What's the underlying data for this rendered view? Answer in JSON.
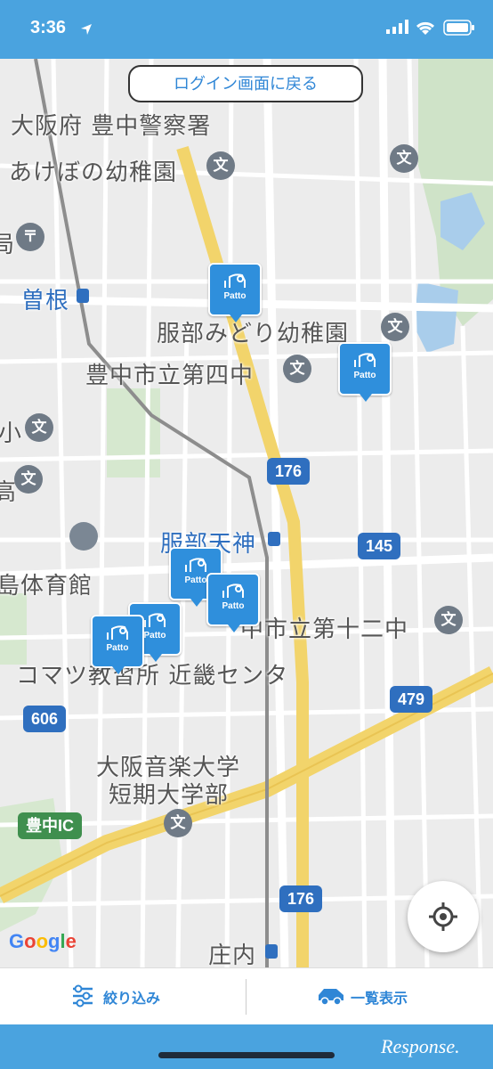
{
  "status_bar": {
    "time": "3:36"
  },
  "login_button": "ログイン画面に戻る",
  "map": {
    "labels": [
      {
        "text": "大阪府 豊中警察署"
      },
      {
        "text": "あけぼの幼稚園"
      },
      {
        "text": "曽根"
      },
      {
        "text": "服部みどり幼稚園"
      },
      {
        "text": "豊中市立第四中"
      },
      {
        "text": "服部天神"
      },
      {
        "text": "島体育館"
      },
      {
        "text": "中市立第十二中"
      },
      {
        "text": "コマツ教習所 近畿センタ"
      },
      {
        "text": "大阪音楽大学"
      },
      {
        "text": "短期大学部"
      },
      {
        "text": "庄内"
      },
      {
        "text": "小"
      },
      {
        "text": "高"
      },
      {
        "text": "局"
      }
    ],
    "routes": [
      "176",
      "145",
      "479",
      "606",
      "176"
    ],
    "ic_label": "豊中IC",
    "poi_glyph": "文",
    "marker_label": "Patto",
    "google": [
      "G",
      "o",
      "o",
      "g",
      "l",
      "e"
    ],
    "google_colors": [
      "#4285f4",
      "#ea4335",
      "#fbbc05",
      "#4285f4",
      "#34a853",
      "#ea4335"
    ]
  },
  "bottom_bar": {
    "filter_label": "絞り込み",
    "list_label": "一覧表示"
  },
  "footer": {
    "watermark": "Response."
  },
  "colors": {
    "accent": "#4aa3df",
    "marker": "#2f8fdc"
  }
}
